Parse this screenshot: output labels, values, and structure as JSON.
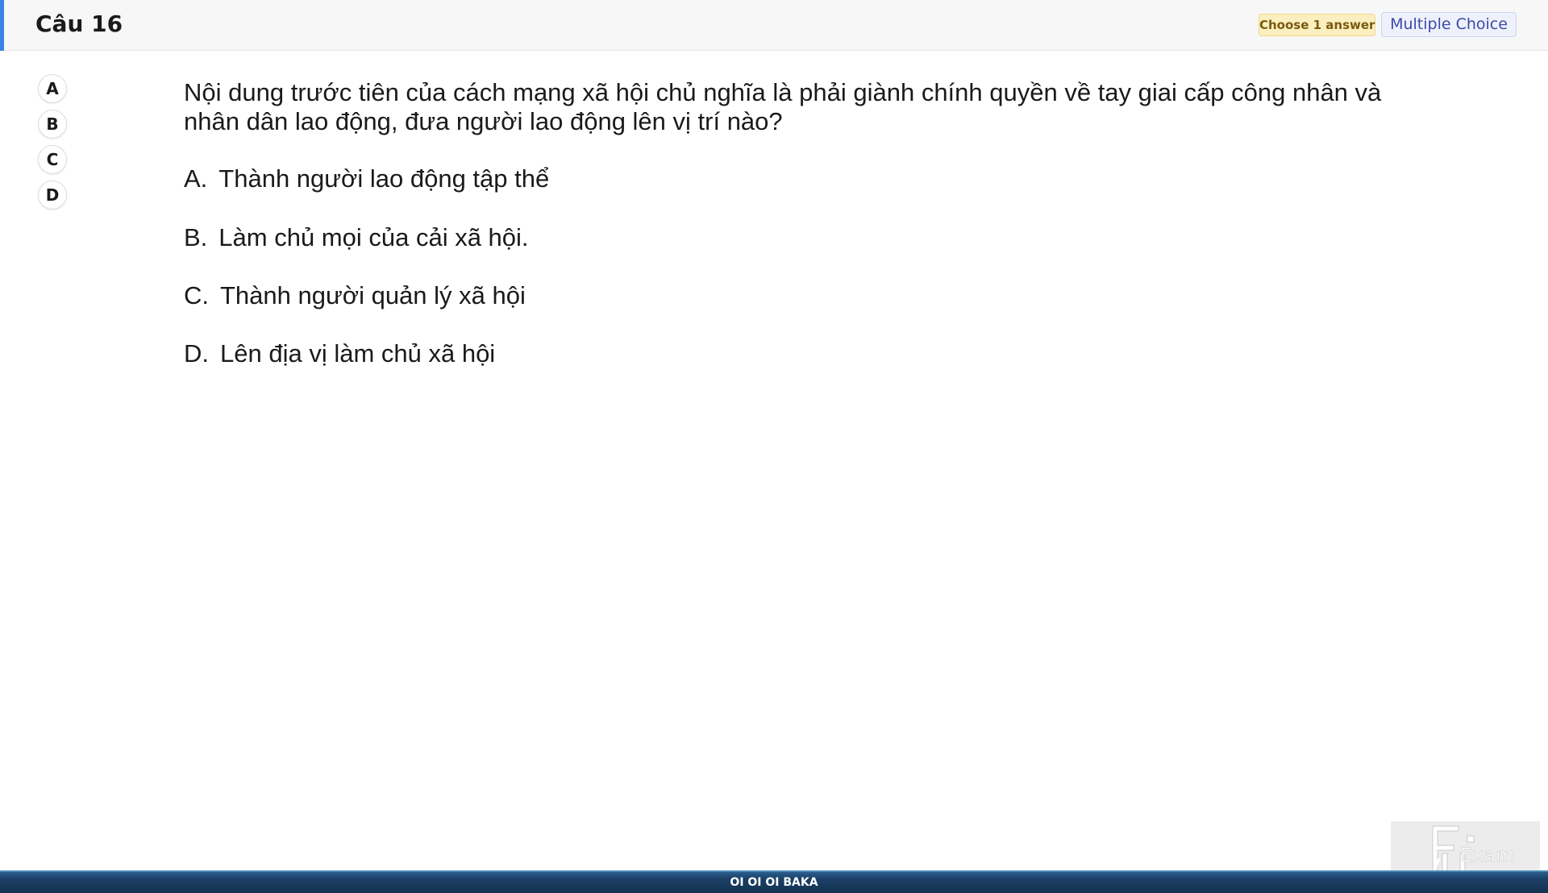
{
  "header": {
    "title": "Câu 16",
    "badge_choose": "Choose 1 answer",
    "badge_type": "Multiple Choice",
    "accent_color": "#3b82e6"
  },
  "answer_buttons": [
    "A",
    "B",
    "C",
    "D"
  ],
  "question": {
    "text": "Nội dung trước tiên của cách mạng xã hội chủ nghĩa là phải giành chính quyền về tay giai cấp công nhân và nhân dân lao động, đưa người lao động lên vị trí nào?",
    "options": [
      {
        "letter": "A.",
        "text": "Thành người lao động tập thể"
      },
      {
        "letter": "B.",
        "text": "Làm chủ mọi của cải xã hội."
      },
      {
        "letter": "C.",
        "text": "Thành người quản lý xã hội"
      },
      {
        "letter": "D.",
        "text": "Lên địa vị làm chủ xã hội"
      }
    ]
  },
  "logo": {
    "icon": "fu-exam-logo",
    "text": "Exam"
  },
  "footer": {
    "text": "OI OI OI BAKA"
  }
}
